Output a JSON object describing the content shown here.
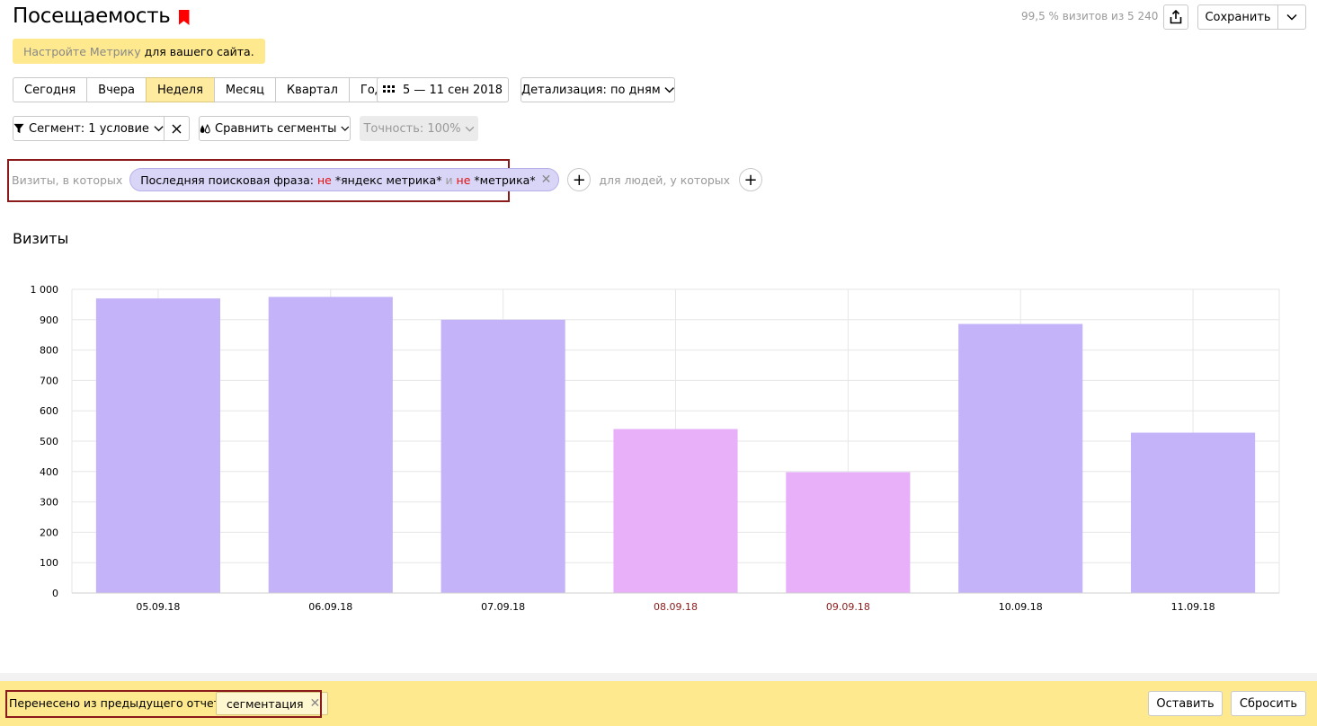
{
  "header": {
    "title": "Посещаемость",
    "visits_info": "99,5 % визитов из 5 240",
    "save_label": "Сохранить"
  },
  "banner": {
    "link_text": "Настройте Метрику",
    "rest_text": "для вашего сайта."
  },
  "period_tabs": [
    {
      "label": "Сегодня",
      "active": false
    },
    {
      "label": "Вчера",
      "active": false
    },
    {
      "label": "Неделя",
      "active": true
    },
    {
      "label": "Месяц",
      "active": false
    },
    {
      "label": "Квартал",
      "active": false
    },
    {
      "label": "Год",
      "active": false
    }
  ],
  "date_range": "5 — 11 сен 2018",
  "detail_label": "Детализация: по дням",
  "segment_label": "Сегмент: 1 условие",
  "compare_label": "Сравнить сегменты",
  "accuracy_label": "Точность: 100%",
  "segment_row": {
    "visits_prefix": "Визиты, в которых",
    "chip_prefix": "Последняя поисковая фраза:",
    "neg1": "не",
    "value1": "*яндекс метрика*",
    "conj": "и",
    "neg2": "не",
    "value2": "*метрика*",
    "people_label": "для людей, у которых"
  },
  "chart_title": "Визиты",
  "chart_data": {
    "type": "bar",
    "categories": [
      "05.09.18",
      "06.09.18",
      "07.09.18",
      "08.09.18",
      "09.09.18",
      "10.09.18",
      "11.09.18"
    ],
    "values": [
      970,
      975,
      900,
      540,
      398,
      886,
      528
    ],
    "weekend": [
      false,
      false,
      false,
      true,
      true,
      false,
      false
    ],
    "ylim": [
      0,
      1000
    ],
    "yticks": [
      "0",
      "100",
      "200",
      "300",
      "400",
      "500",
      "600",
      "700",
      "800",
      "900",
      "1 000"
    ],
    "grid": true,
    "colors": {
      "weekday": "#c4b3f8",
      "weekend": "#e8b0f9",
      "weekend_label": "#8b1a1a"
    }
  },
  "footer": {
    "label": "Перенесено из предыдущего отчета:",
    "tag": "сегментация",
    "keep_label": "Оставить",
    "reset_label": "Сбросить"
  }
}
